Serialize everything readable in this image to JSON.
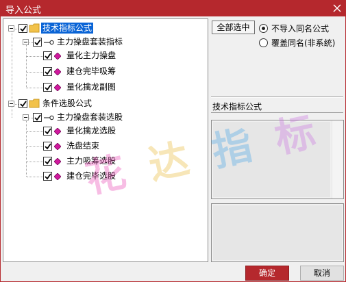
{
  "window": {
    "title": "导入公式"
  },
  "tree": {
    "root1": {
      "label": "技术指标公式",
      "child": {
        "label": "主力操盘套装指标",
        "items": [
          "量化主力操盘",
          "建仓完毕吸筹",
          "量化擒龙副图"
        ]
      }
    },
    "root2": {
      "label": "条件选股公式",
      "child": {
        "label": "主力操盘套装选股",
        "items": [
          "量化擒龙选股",
          "洗盘结束",
          "主力吸筹选股",
          "建仓完毕选股"
        ]
      }
    }
  },
  "options": {
    "select_all_label": "全部选中",
    "radio_skip_label": "不导入同名公式",
    "radio_overwrite_label": "覆盖同名(非系统)",
    "selected": "skip"
  },
  "description": {
    "title": "技术指标公式"
  },
  "buttons": {
    "ok_label": "确定",
    "cancel_label": "取消"
  },
  "watermark": {
    "chars": [
      "花",
      "达",
      "指",
      "标"
    ]
  },
  "colors": {
    "accent": "#b5282d",
    "selection": "#0a64d6",
    "folder": "#f2c24a",
    "item_icon": "#d0199e"
  }
}
